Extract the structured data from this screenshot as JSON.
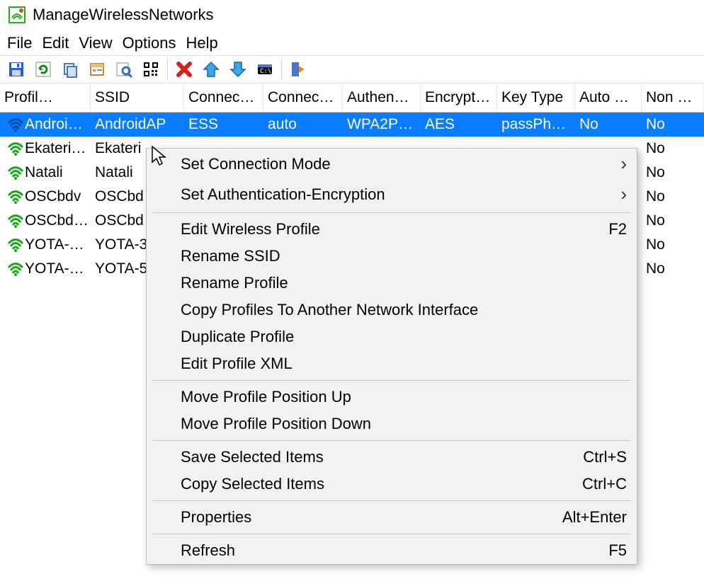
{
  "window": {
    "title": "ManageWirelessNetworks"
  },
  "menu": {
    "items": [
      "File",
      "Edit",
      "View",
      "Options",
      "Help"
    ]
  },
  "toolbar": {
    "icons": [
      "save",
      "refresh",
      "copy",
      "properties",
      "find",
      "qr",
      "delete",
      "up",
      "down",
      "cmd",
      "exit"
    ]
  },
  "columns": [
    "Profil…",
    "SSID",
    "Connec…",
    "Connec…",
    "Authen…",
    "Encrypt…",
    "Key Type",
    "Auto S…",
    "Non B…"
  ],
  "rows": [
    {
      "selected": true,
      "wifi": "blue",
      "cells": [
        "Androi…",
        "AndroidAP",
        "ESS",
        "auto",
        "WPA2P…",
        "AES",
        "passPhr…",
        "No",
        "No"
      ]
    },
    {
      "selected": false,
      "wifi": "green",
      "cells": [
        "Ekateri…",
        "Ekateri",
        "",
        "",
        "",
        "",
        "",
        "",
        "No"
      ]
    },
    {
      "selected": false,
      "wifi": "green",
      "cells": [
        "Natali",
        "Natali",
        "",
        "",
        "",
        "",
        "",
        "",
        "No"
      ]
    },
    {
      "selected": false,
      "wifi": "green",
      "cells": [
        "OSCbdv",
        "OSCbd",
        "",
        "",
        "",
        "",
        "",
        "",
        "No"
      ]
    },
    {
      "selected": false,
      "wifi": "green",
      "cells": [
        "OSCbd…",
        "OSCbd",
        "",
        "",
        "",
        "",
        "",
        "",
        "No"
      ]
    },
    {
      "selected": false,
      "wifi": "green",
      "cells": [
        "YOTA-…",
        "YOTA-3",
        "",
        "",
        "",
        "",
        "",
        "",
        "No"
      ]
    },
    {
      "selected": false,
      "wifi": "green",
      "cells": [
        "YOTA-…",
        "YOTA-5",
        "",
        "",
        "",
        "",
        "",
        "",
        "No"
      ]
    }
  ],
  "context_menu": {
    "groups": [
      [
        {
          "label": "Set Connection Mode",
          "submenu": true,
          "shortcut": ""
        },
        {
          "label": "Set Authentication-Encryption",
          "submenu": true,
          "shortcut": ""
        }
      ],
      [
        {
          "label": "Edit Wireless Profile",
          "submenu": false,
          "shortcut": "F2"
        },
        {
          "label": "Rename SSID",
          "submenu": false,
          "shortcut": ""
        },
        {
          "label": "Rename Profile",
          "submenu": false,
          "shortcut": ""
        },
        {
          "label": "Copy Profiles To Another Network Interface",
          "submenu": false,
          "shortcut": ""
        },
        {
          "label": "Duplicate Profile",
          "submenu": false,
          "shortcut": ""
        },
        {
          "label": "Edit Profile XML",
          "submenu": false,
          "shortcut": ""
        }
      ],
      [
        {
          "label": "Move Profile Position Up",
          "submenu": false,
          "shortcut": ""
        },
        {
          "label": "Move Profile Position Down",
          "submenu": false,
          "shortcut": ""
        }
      ],
      [
        {
          "label": "Save Selected Items",
          "submenu": false,
          "shortcut": "Ctrl+S"
        },
        {
          "label": "Copy Selected Items",
          "submenu": false,
          "shortcut": "Ctrl+C"
        }
      ],
      [
        {
          "label": "Properties",
          "submenu": false,
          "shortcut": "Alt+Enter"
        }
      ],
      [
        {
          "label": "Refresh",
          "submenu": false,
          "shortcut": "F5"
        }
      ]
    ]
  }
}
